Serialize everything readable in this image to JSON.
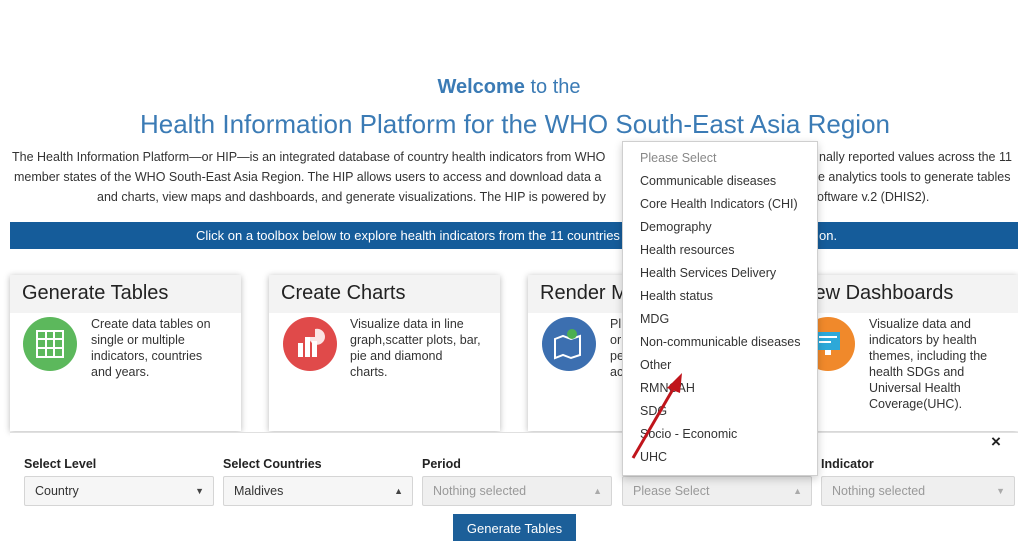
{
  "header": {
    "welcome_bold": "Welcome",
    "welcome_rest": " to the",
    "platform_title": "Health Information Platform for the WHO South-East Asia Region",
    "intro_lines": [
      "The Health Information Platform—or HIP—is an integrated database of country health indicators from WHO",
      "member states of the WHO South-East Asia Region. The HIP allows users to access and download data a",
      "and charts, view maps and dashboards, and generate visualizations. The HIP is powered by",
      "nally reported values across the 11",
      "e analytics tools to generate tables",
      "oftware v.2 (DHIS2)."
    ]
  },
  "banner": {
    "text_left": "Click on a toolbox below to explore health indicators from the 11 countries i",
    "text_right": "on."
  },
  "cards": [
    {
      "title": "Generate Tables",
      "desc": [
        "Create data tables on",
        "single or multiple",
        "indicators, countries",
        "and years."
      ],
      "icon_color": "#5cb85c"
    },
    {
      "title": "Create Charts",
      "desc": [
        "Visualize data in line",
        "graph,scatter plots, bar,",
        "pie and diamond",
        "charts."
      ],
      "icon_color": "#e04a4a"
    },
    {
      "title": "Render M",
      "desc": [
        "Pl",
        "or",
        "pe",
        "ac"
      ],
      "icon_color": "#3c6fb0"
    },
    {
      "title": "iew Dashboards",
      "desc": [
        "Visualize data and",
        "indicators by health",
        "themes, including the",
        "health SDGs and",
        "Universal Health",
        "Coverage(UHC)."
      ],
      "icon_color": "#f0892b"
    }
  ],
  "panel": {
    "close_label": "×",
    "fields": [
      {
        "label": "Select Level",
        "value": "Country",
        "caret": "▼"
      },
      {
        "label": "Select Countries",
        "value": "Maldives",
        "caret": "▲"
      },
      {
        "label": "Period",
        "value": "Nothing selected",
        "caret": "▲"
      },
      {
        "label": "",
        "value": "Please Select",
        "caret": "▲"
      },
      {
        "label": "Indicator",
        "value": "Nothing selected",
        "caret": "▼"
      }
    ],
    "generate_button": "Generate Tables"
  },
  "dropdown": {
    "items": [
      "Please Select",
      "Communicable diseases",
      "Core Health Indicators (CHI)",
      "Demography",
      "Health resources",
      "Health Services Delivery",
      "Health status",
      "MDG",
      "Non-communicable diseases",
      "Other",
      "RMNCAH",
      "SDG",
      "Socio - Economic",
      "UHC"
    ]
  },
  "colors": {
    "title_blue": "#3b7bb5",
    "banner_blue": "#155c9a",
    "button_blue": "#1c5f99",
    "arrow_red": "#c0141b"
  }
}
